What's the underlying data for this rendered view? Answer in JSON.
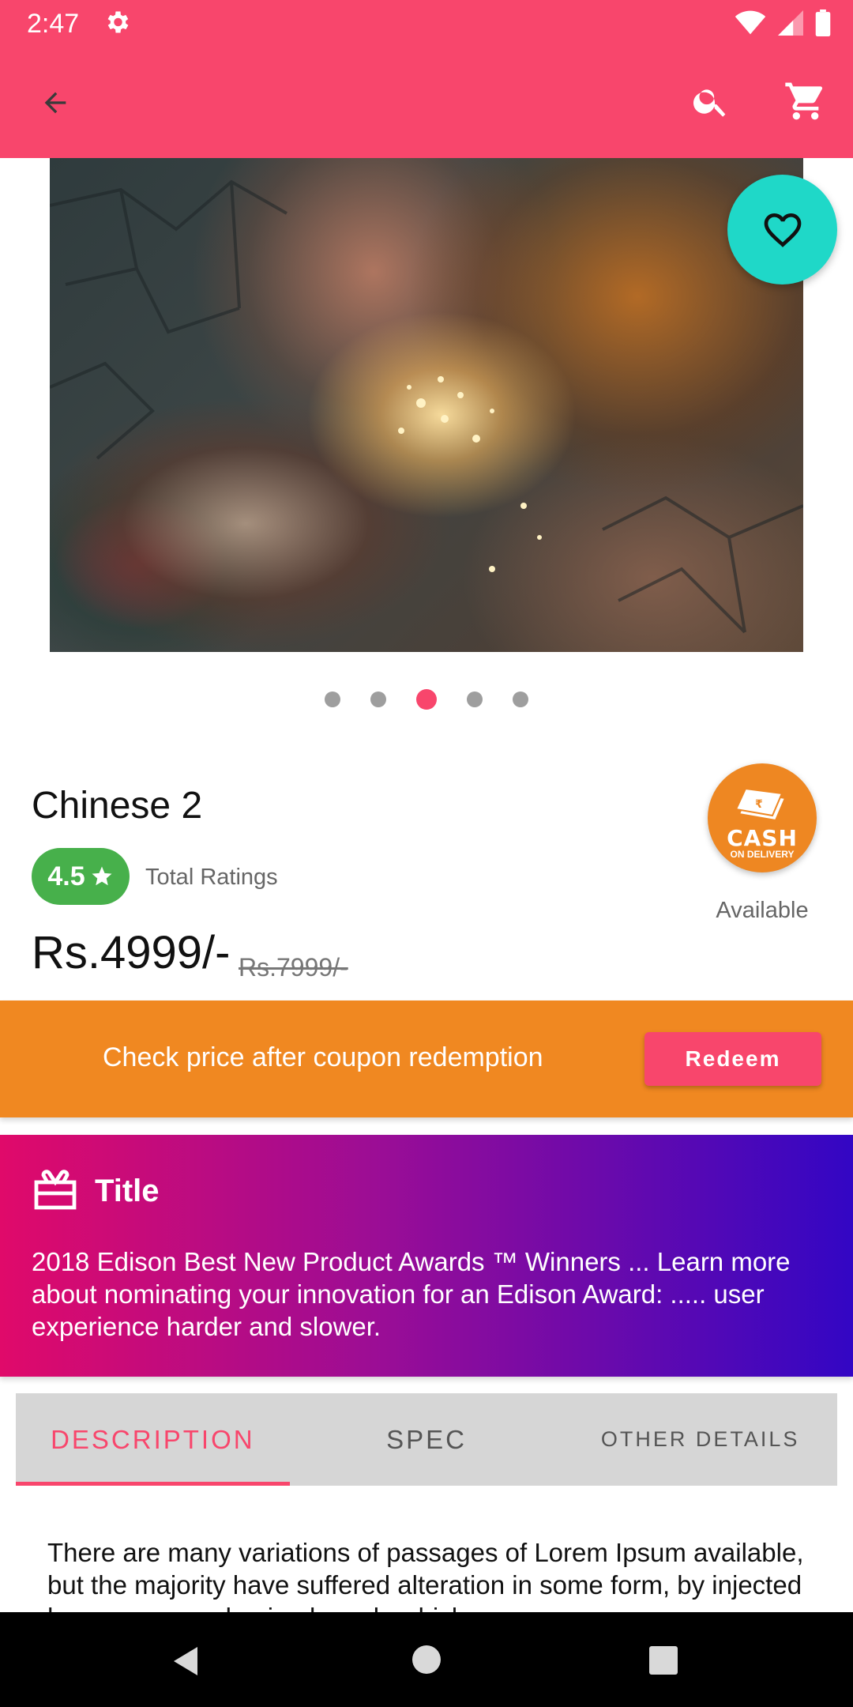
{
  "status_bar": {
    "time": "2:47",
    "icons": [
      "settings-icon",
      "wifi-icon",
      "signal-icon",
      "battery-icon"
    ]
  },
  "app_bar": {
    "color": "#f8466c",
    "icons": [
      "back-arrow-icon",
      "search-icon",
      "cart-icon"
    ]
  },
  "gallery": {
    "image_subject": "two women holding glowing string lights on cracked ground",
    "page_count": 5,
    "active_page": 3,
    "favorite_icon": "heart-outline-icon"
  },
  "product": {
    "name": "Chinese 2",
    "rating": "4.5",
    "rating_icon": "star-icon",
    "ratings_label": "Total Ratings",
    "price": "Rs.4999/-",
    "old_price": "Rs.7999/-",
    "cod_badge_line1": "CASH",
    "cod_badge_line2": "ON DELIVERY",
    "availability": "Available"
  },
  "coupon": {
    "text": "Check price after coupon redemption",
    "button_label": "Redeem",
    "color": "#f08821"
  },
  "promo": {
    "icon": "gift-card-icon",
    "title": "Title",
    "body": "2018 Edison Best New Product Awards ™ Winners ... Learn more about nominating your innovation for an Edison Award: ..... user experience harder and slower."
  },
  "tabs": [
    {
      "label": "DESCRIPTION",
      "active": true
    },
    {
      "label": "SPEC",
      "active": false
    },
    {
      "label": "OTHER DETAILS",
      "active": false
    }
  ],
  "description": {
    "text": "There are many variations of passages of Lorem Ipsum available, but the majority have suffered alteration in some form, by injected humour, or randomised words which"
  },
  "nav_bar": {
    "icons": [
      "nav-back-icon",
      "nav-home-icon",
      "nav-recents-icon"
    ]
  }
}
